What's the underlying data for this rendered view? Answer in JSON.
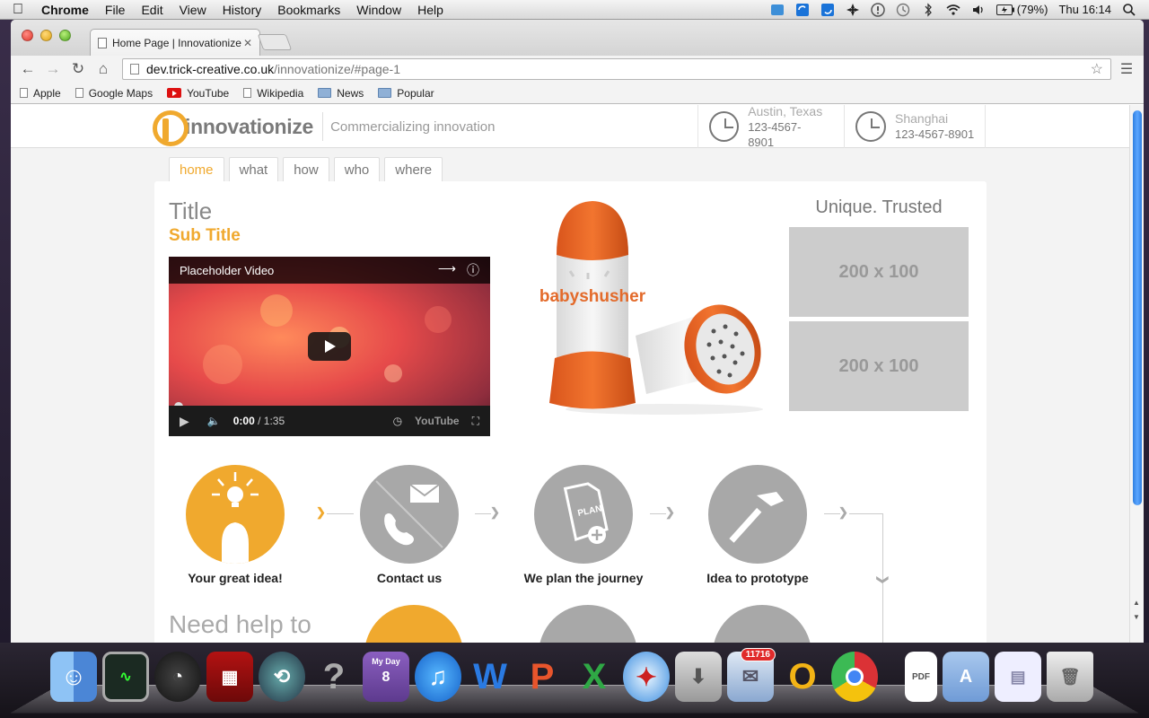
{
  "menubar": {
    "app": "Chrome",
    "items": [
      "File",
      "Edit",
      "View",
      "History",
      "Bookmarks",
      "Window",
      "Help"
    ],
    "battery": "(79%)",
    "clock": "Thu 16:14"
  },
  "browser": {
    "tab_title": "Home Page | Innovationize",
    "url_host": "dev.trick-creative.co.uk",
    "url_path": "/innovationize/#page-1",
    "bookmarks": [
      {
        "label": "Apple",
        "icon": "page-icon"
      },
      {
        "label": "Google Maps",
        "icon": "page-icon"
      },
      {
        "label": "YouTube",
        "icon": "youtube-icon"
      },
      {
        "label": "Wikipedia",
        "icon": "page-icon"
      },
      {
        "label": "News",
        "icon": "folder-icon"
      },
      {
        "label": "Popular",
        "icon": "folder-icon"
      }
    ]
  },
  "site": {
    "logo_text": "innovationize",
    "tagline": "Commercializing innovation",
    "offices": [
      {
        "city": "Austin, Texas",
        "phone": "123-4567-8901"
      },
      {
        "city": "Shanghai",
        "phone": "123-4567-8901"
      }
    ],
    "nav": [
      "home",
      "what",
      "how",
      "who",
      "where"
    ],
    "active_nav": "home",
    "title": "Title",
    "subtitle": "Sub Title",
    "video": {
      "title": "Placeholder Video",
      "time_current": "0:00",
      "time_total": " / 1:35",
      "brand": "YouTube"
    },
    "product_brand": "babyshusher",
    "unique_heading": "Unique. Trusted",
    "placeholders": [
      "200 x 100",
      "200 x 100"
    ],
    "steps": [
      {
        "label": "Your great idea!",
        "icon": "lightbulb-head-icon",
        "active": true
      },
      {
        "label": "Contact us",
        "icon": "phone-envelope-icon",
        "active": false
      },
      {
        "label": "We plan the journey",
        "icon": "plan-document-icon",
        "active": false
      },
      {
        "label": "Idea to prototype",
        "icon": "hammer-icon",
        "active": false
      }
    ],
    "plan_icon_text": "PLAN",
    "need_help": "Need help to"
  },
  "dock": {
    "mail_badge": "11716",
    "calendar_text": "My Day",
    "calendar_number": "8"
  },
  "colors": {
    "accent": "#f0a92e",
    "step_grey": "#a8a8a8",
    "placeholder_grey": "#cccccc"
  }
}
